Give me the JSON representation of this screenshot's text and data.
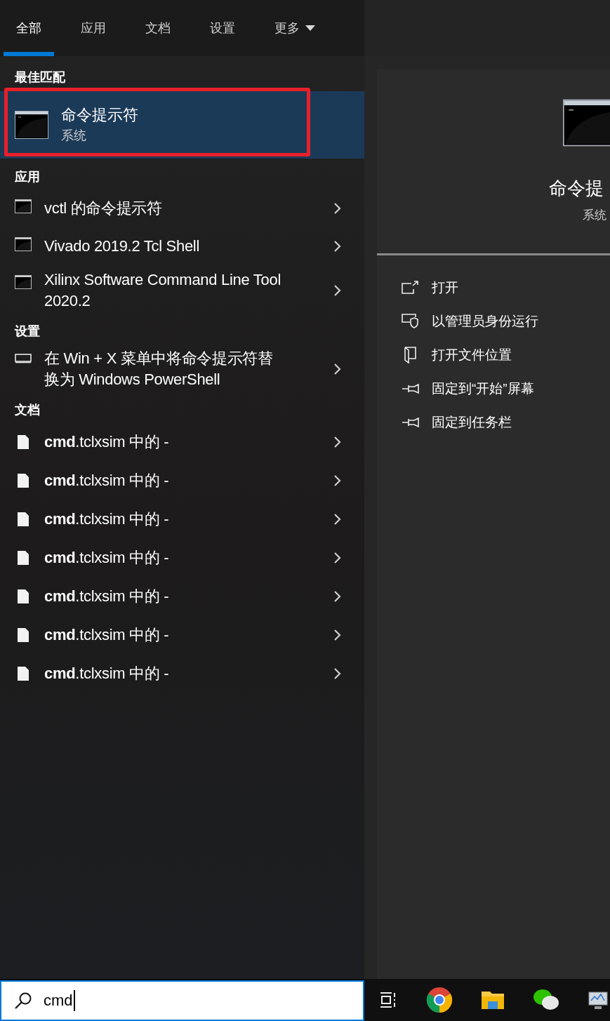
{
  "tabs": [
    {
      "label": "全部",
      "selected": true,
      "dropdown": false
    },
    {
      "label": "应用",
      "selected": false,
      "dropdown": false
    },
    {
      "label": "文档",
      "selected": false,
      "dropdown": false
    },
    {
      "label": "设置",
      "selected": false,
      "dropdown": false
    },
    {
      "label": "更多",
      "selected": false,
      "dropdown": true
    }
  ],
  "best_match": {
    "heading": "最佳匹配",
    "title": "命令提示符",
    "subtitle": "系统",
    "selected": true,
    "highlighted": true
  },
  "sections": [
    {
      "heading": "应用",
      "items": [
        {
          "kind": "app",
          "title": "vctl 的命令提示符"
        },
        {
          "kind": "app",
          "title": "Vivado 2019.2 Tcl Shell"
        },
        {
          "kind": "app",
          "title": "Xilinx Software Command Line Tool 2020.2"
        }
      ]
    },
    {
      "heading": "设置",
      "items": [
        {
          "kind": "setting",
          "title": "在 Win + X 菜单中将命令提示符替换为 Windows PowerShell"
        }
      ]
    },
    {
      "heading": "文档",
      "items": [
        {
          "kind": "document",
          "title": "**cmd**.tclxsim 中的 -"
        },
        {
          "kind": "document",
          "title": "**cmd**.tclxsim 中的 -"
        },
        {
          "kind": "document",
          "title": "**cmd**.tclxsim 中的 -"
        },
        {
          "kind": "document",
          "title": "**cmd**.tclxsim 中的 -"
        },
        {
          "kind": "document",
          "title": "**cmd**.tclxsim 中的 -"
        },
        {
          "kind": "document",
          "title": "**cmd**.tclxsim 中的 -"
        },
        {
          "kind": "document",
          "title": "**cmd**.tclxsim 中的 -"
        }
      ]
    }
  ],
  "details": {
    "title": "命令提",
    "subtitle": "系统",
    "actions": [
      {
        "kind": "open",
        "label": "打开"
      },
      {
        "kind": "admin",
        "label": "以管理员身份运行"
      },
      {
        "kind": "folder",
        "label": "打开文件位置"
      },
      {
        "kind": "pin",
        "label": "固定到“开始”屏幕"
      },
      {
        "kind": "pin",
        "label": "固定到任务栏"
      }
    ]
  },
  "search": {
    "value": "cmd"
  },
  "taskbar": [
    {
      "kind": "taskview"
    },
    {
      "kind": "browser"
    },
    {
      "kind": "folder"
    },
    {
      "kind": "chat"
    },
    {
      "kind": "monitor"
    }
  ]
}
